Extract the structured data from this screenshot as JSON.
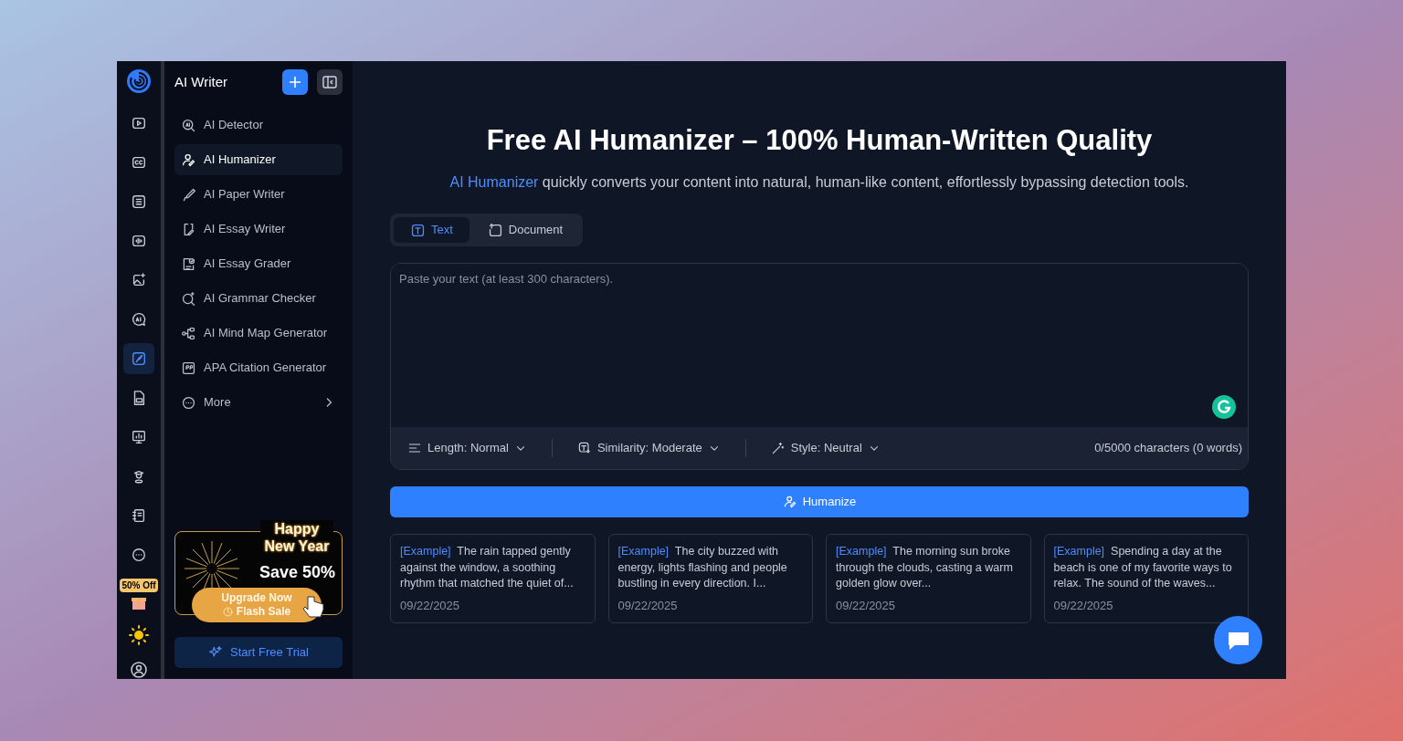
{
  "rail": [
    {
      "kind": "logo",
      "selected": false
    },
    {
      "kind": "video",
      "selected": false
    },
    {
      "kind": "captions",
      "selected": false
    },
    {
      "kind": "list",
      "selected": false
    },
    {
      "kind": "audio",
      "selected": false
    },
    {
      "kind": "image",
      "selected": false
    },
    {
      "kind": "ai-chat",
      "selected": false
    },
    {
      "kind": "writer",
      "selected": true
    },
    {
      "kind": "pdf",
      "selected": false
    },
    {
      "kind": "chart",
      "selected": false
    },
    {
      "kind": "graduate",
      "selected": false
    },
    {
      "kind": "notebook",
      "selected": false
    },
    {
      "kind": "more",
      "selected": false
    }
  ],
  "rail_badge": "50% Off",
  "sidebar": {
    "title": "AI Writer",
    "items": [
      {
        "label": "AI Detector",
        "kind": "detector",
        "selected": false
      },
      {
        "label": "AI Humanizer",
        "kind": "humanizer",
        "selected": true
      },
      {
        "label": "AI Paper Writer",
        "kind": "pen",
        "selected": false
      },
      {
        "label": "AI Essay Writer",
        "kind": "doc",
        "selected": false
      },
      {
        "label": "AI Essay Grader",
        "kind": "grader",
        "selected": false
      },
      {
        "label": "AI Grammar Checker",
        "kind": "grammar",
        "selected": false
      },
      {
        "label": "AI Mind Map Generator",
        "kind": "mindmap",
        "selected": false
      },
      {
        "label": "APA Citation Generator",
        "kind": "citation",
        "selected": false
      },
      {
        "label": "More",
        "kind": "more",
        "selected": false
      }
    ],
    "promo": {
      "title": "Happy New Year",
      "offer": "Save 50%",
      "button": "Upgrade Now",
      "subtitle": "Flash Sale"
    },
    "trial_button": "Start Free Trial"
  },
  "main": {
    "heading": "Free AI Humanizer – 100% Human-Written Quality",
    "intro_link": "AI Humanizer",
    "intro": " quickly converts your content into natural, human-like content, effortlessly bypassing detection tools.",
    "tabs": [
      {
        "label": "Text",
        "selected": true
      },
      {
        "label": "Document",
        "selected": false
      }
    ],
    "input": {
      "placeholder": "Paste your text (at least 300 characters)."
    },
    "options": [
      {
        "kind": "length",
        "label": "Length: Normal"
      },
      {
        "kind": "similarity",
        "label": "Similarity: Moderate"
      },
      {
        "kind": "style",
        "label": "Style: Neutral"
      }
    ],
    "counter": "0/5000 characters (0 words)",
    "button": "Humanize",
    "examples": [
      {
        "tag": "[Example]",
        "text": "The rain tapped gently against the window, a soothing rhythm that matched the quiet of...",
        "date": "09/22/2025"
      },
      {
        "tag": "[Example]",
        "text": "The city buzzed with energy, lights flashing and people bustling in every direction. I...",
        "date": "09/22/2025"
      },
      {
        "tag": "[Example]",
        "text": "The morning sun broke through the clouds, casting a warm golden glow over...",
        "date": "09/22/2025"
      },
      {
        "tag": "[Example]",
        "text": "Spending a day at the beach is one of my favorite ways to relax. The sound of the waves...",
        "date": "09/22/2025"
      }
    ]
  }
}
